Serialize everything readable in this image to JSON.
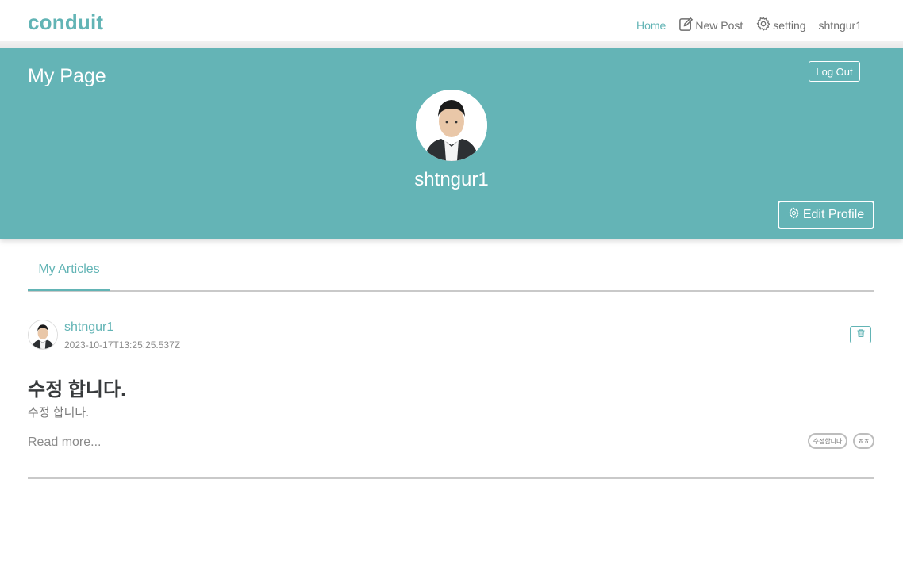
{
  "navbar": {
    "brand": "conduit",
    "links": [
      {
        "label": "Home",
        "icon": null,
        "active": true
      },
      {
        "label": "New Post",
        "icon": "edit-icon",
        "active": false
      },
      {
        "label": "setting",
        "icon": "gear-icon",
        "active": false
      },
      {
        "label": "shtngur1",
        "icon": null,
        "active": false
      }
    ]
  },
  "banner": {
    "title": "My Page",
    "logout_label": "Log Out",
    "username": "shtngur1",
    "edit_profile_label": "Edit Profile"
  },
  "tabs": [
    {
      "label": "My Articles",
      "active": true
    }
  ],
  "article": {
    "author": "shtngur1",
    "date": "2023-10-17T13:25:25.537Z",
    "title": "수정 합니다.",
    "description": "수정 합니다.",
    "read_more": "Read more...",
    "tags": [
      "수정합니다",
      "ㅎㅎ"
    ]
  },
  "colors": {
    "accent": "#62b4b5",
    "banner_bg": "#64b4b6"
  }
}
